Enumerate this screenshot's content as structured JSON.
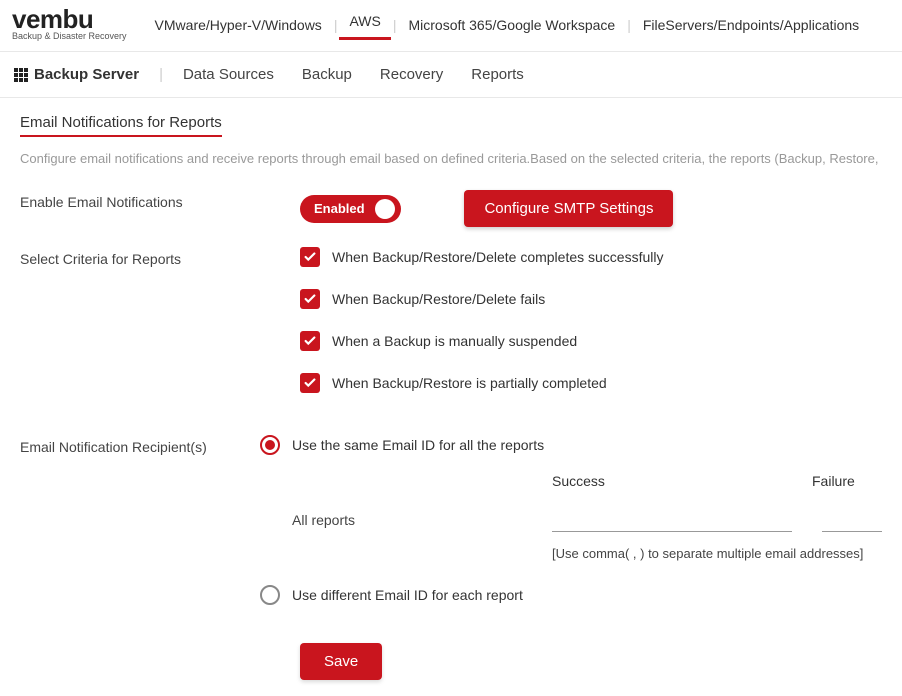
{
  "logo": {
    "text": "vembu",
    "sub": "Backup & Disaster Recovery"
  },
  "topnav": {
    "items": [
      {
        "label": "VMware/Hyper-V/Windows"
      },
      {
        "label": "AWS"
      },
      {
        "label": "Microsoft 365/Google Workspace"
      },
      {
        "label": "FileServers/Endpoints/Applications"
      }
    ]
  },
  "secondbar": {
    "server": "Backup Server",
    "items": [
      {
        "label": "Data Sources"
      },
      {
        "label": "Backup"
      },
      {
        "label": "Recovery"
      },
      {
        "label": "Reports"
      }
    ]
  },
  "page": {
    "title": "Email Notifications for Reports",
    "desc": "Configure email notifications and receive reports through email based on defined criteria.Based on the selected criteria, the reports (Backup, Restore, Delete) will be emai"
  },
  "labels": {
    "enable": "Enable Email Notifications",
    "criteria": "Select Criteria for Reports",
    "recipients": "Email Notification Recipient(s)"
  },
  "toggle": {
    "state": "Enabled"
  },
  "buttons": {
    "smtp": "Configure SMTP Settings",
    "save": "Save"
  },
  "criteria": [
    {
      "label": "When Backup/Restore/Delete completes successfully"
    },
    {
      "label": "When Backup/Restore/Delete fails"
    },
    {
      "label": "When a Backup is manually suspended"
    },
    {
      "label": "When Backup/Restore is partially completed"
    }
  ],
  "recipient_options": {
    "same": "Use the same Email ID for all the reports",
    "diff": "Use different Email ID for each report"
  },
  "email_table": {
    "col_success": "Success",
    "col_failure": "Failure",
    "row_label": "All reports",
    "hint": "[Use comma( , ) to separate multiple email addresses]"
  }
}
